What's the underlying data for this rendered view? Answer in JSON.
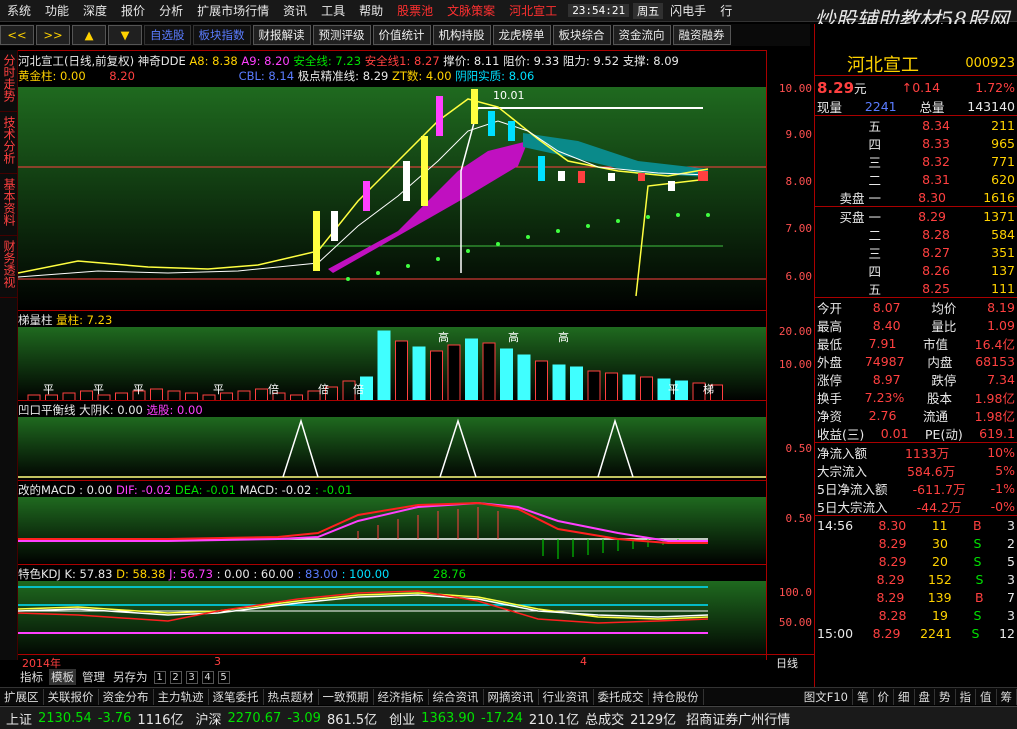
{
  "menu": {
    "items": [
      "系统",
      "功能",
      "深度",
      "报价",
      "分析",
      "扩展市场行情",
      "资讯",
      "工具",
      "帮助"
    ],
    "red_items": [
      "股票池",
      "文脉策案",
      "河北宣工"
    ],
    "time": "23:54:21",
    "weekday": "周五",
    "flash": "闪电手",
    "extra": "行"
  },
  "watermark": {
    "title": "炒股辅助教材58股网",
    "url": "www.58Gu.com"
  },
  "toolbar": {
    "nav": [
      "<<",
      ">>",
      "▲",
      "▼"
    ],
    "blue": [
      "自选股",
      "板块指数"
    ],
    "buttons": [
      "财报解读",
      "预测评级",
      "价值统计",
      "机构持股",
      "龙虎榜单",
      "板块综合",
      "资金流向",
      "融资融券"
    ]
  },
  "left_tabs": [
    "分时走势",
    "技术分析",
    "基本资料",
    "财务透视"
  ],
  "main_panel": {
    "title": "河北宣工(日线,前复权) 神奇DDE",
    "a8": "A8: 8.38",
    "a9": "A9: 8.20",
    "safe1": "安全线: 7.23",
    "safe2": "安全线1: 8.27",
    "bar_price": "撑价: 8.11",
    "resist_price": "阻价: 9.33",
    "resist": "阻力: 9.52",
    "support": "支撑: 8.09",
    "gold": "黄金柱: 0.00",
    "gold_val": "8.20",
    "cbl": "CBL: 8.14",
    "pivot": "极点精准线: 8.29",
    "zt": "ZT数: 4.00",
    "yy": "阴阳实质: 8.06",
    "peak_label": "10.01",
    "yaxis": [
      "10.00",
      "9.00",
      "8.00",
      "7.00",
      "6.00"
    ]
  },
  "vol_panel": {
    "title": "梯量柱",
    "value": "量柱: 7.23",
    "labels": [
      "平",
      "平",
      "平",
      "平",
      "倍",
      "倍",
      "倍",
      "高",
      "高",
      "高",
      "平",
      "梯"
    ],
    "yaxis": [
      "20.00",
      "10.00"
    ]
  },
  "pit_panel": {
    "title": "凹口平衡线",
    "k": "大阴K: 0.00",
    "pick": "选股: 0.00",
    "yaxis": [
      "0.50"
    ]
  },
  "macd_panel": {
    "title": "改的MACD",
    "v0": ": 0.00",
    "dif": "DIF: -0.02",
    "dea": "DEA: -0.01",
    "macd": "MACD: -0.02",
    "v1": ": -0.01",
    "yaxis": [
      "0.50"
    ]
  },
  "kdj_panel": {
    "title": "特色KDJ",
    "k": "K: 57.83",
    "d": "D: 58.38",
    "j": "J: 56.73",
    "v1": ": 0.00",
    "v2": ": 60.00",
    "v3": ": 83.00",
    "v4": ": 100.00",
    "v5": "28.76",
    "yaxis": [
      "100.0",
      "50.00"
    ]
  },
  "date_bar": {
    "year": "2014年",
    "m1": "3",
    "m2": "4",
    "period": "日线"
  },
  "bottom_tabs": {
    "items": [
      "指标",
      "模板",
      "管理",
      "另存为"
    ],
    "pages": [
      "1",
      "2",
      "3",
      "4",
      "5"
    ]
  },
  "info_tabs": [
    "扩展区",
    "关联报价",
    "资金分布",
    "主力轨迹",
    "逐笔委托",
    "热点题材",
    "一致预期",
    "经济指标",
    "综合资讯",
    "网摘资讯",
    "行业资讯",
    "委托成交",
    "持仓股份"
  ],
  "info_tabs_right": [
    "图文F10",
    "笔",
    "价",
    "细",
    "盘",
    "势",
    "指",
    "值",
    "筹"
  ],
  "ticker": [
    {
      "name": "上证",
      "val": "2130.54",
      "chg": "-3.76",
      "amt": "1116亿"
    },
    {
      "name": "沪深",
      "val": "2270.67",
      "chg": "-3.09",
      "amt": "861.5亿"
    },
    {
      "name": "创业",
      "val": "1363.90",
      "chg": "-17.24",
      "amt": "210.1亿"
    }
  ],
  "ticker_total": {
    "label": "总成交",
    "val": "2129亿"
  },
  "broker": "招商证券广州行情",
  "quote": {
    "name": "河北宣工",
    "code": "000923",
    "price": "8.29",
    "unit": "元",
    "chg": "0.14",
    "pct": "1.72%",
    "now_label": "现量",
    "now_val": "2241",
    "total_label": "总量",
    "total_val": "143140",
    "asks": [
      {
        "l": "五",
        "p": "8.34",
        "v": "211"
      },
      {
        "l": "四",
        "p": "8.33",
        "v": "965"
      },
      {
        "l": "三",
        "p": "8.32",
        "v": "771"
      },
      {
        "l": "二",
        "p": "8.31",
        "v": "620"
      },
      {
        "l": "卖盘 一",
        "p": "8.30",
        "v": "1616"
      }
    ],
    "bids": [
      {
        "l": "买盘 一",
        "p": "8.29",
        "v": "1371"
      },
      {
        "l": "二",
        "p": "8.28",
        "v": "584"
      },
      {
        "l": "三",
        "p": "8.27",
        "v": "351"
      },
      {
        "l": "四",
        "p": "8.26",
        "v": "137"
      },
      {
        "l": "五",
        "p": "8.25",
        "v": "111"
      }
    ],
    "stats": [
      [
        "今开",
        "8.07",
        "均价",
        "8.19"
      ],
      [
        "最高",
        "8.40",
        "量比",
        "1.09"
      ],
      [
        "最低",
        "7.91",
        "市值",
        "16.4亿"
      ],
      [
        "外盘",
        "74987",
        "内盘",
        "68153"
      ],
      [
        "涨停",
        "8.97",
        "跌停",
        "7.34"
      ],
      [
        "换手",
        "7.23%",
        "股本",
        "1.98亿"
      ],
      [
        "净资",
        "2.76",
        "流通",
        "1.98亿"
      ],
      [
        "收益(三)",
        "0.01",
        "PE(动)",
        "619.1"
      ]
    ],
    "flows": [
      [
        "净流入额",
        "1133万",
        "10%"
      ],
      [
        "大宗流入",
        "584.6万",
        "5%"
      ],
      [
        "5日净流入额",
        "-611.7万",
        "-1%"
      ],
      [
        "5日大宗流入",
        "-44.2万",
        "-0%"
      ]
    ],
    "ticks": [
      [
        "14:56",
        "8.30",
        "11",
        "B",
        "3"
      ],
      [
        "",
        "8.29",
        "30",
        "S",
        "2"
      ],
      [
        "",
        "8.29",
        "20",
        "S",
        "5"
      ],
      [
        "",
        "8.29",
        "152",
        "S",
        "3"
      ],
      [
        "",
        "8.29",
        "139",
        "B",
        "7"
      ],
      [
        "",
        "8.28",
        "19",
        "S",
        "3"
      ],
      [
        "15:00",
        "8.29",
        "2241",
        "S",
        "12"
      ]
    ]
  }
}
